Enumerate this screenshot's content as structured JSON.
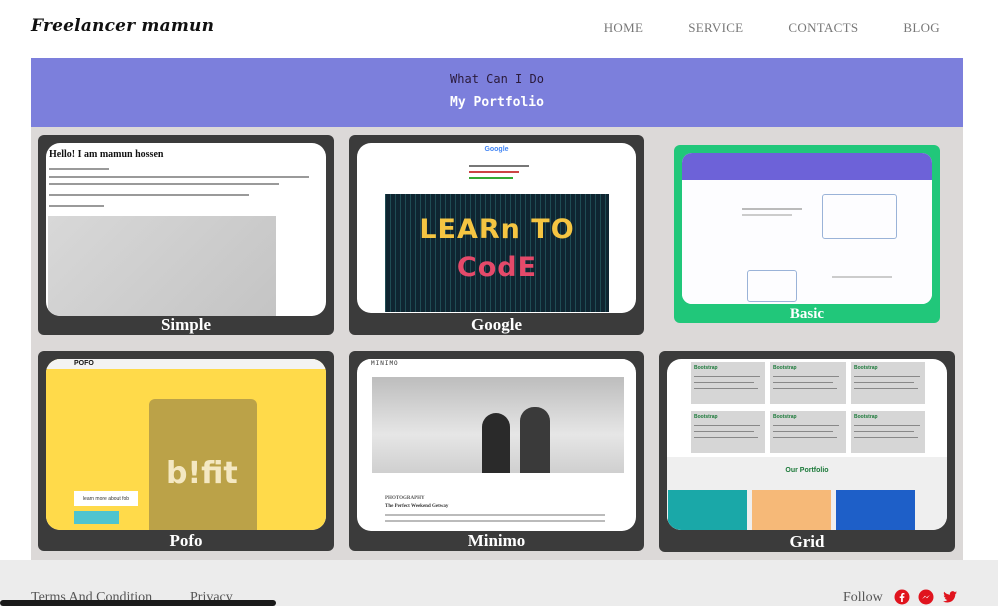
{
  "header": {
    "brand": "Freelancer mamun",
    "nav": [
      "HOME",
      "SERVICE",
      "CONTACTS",
      "BLOG"
    ]
  },
  "banner": {
    "subtitle": "What Can I Do",
    "title": "My Portfolio"
  },
  "portfolio": {
    "cards": [
      {
        "label": "Simple",
        "preview_heading": "Hello! I am mamun hossen"
      },
      {
        "label": "Google",
        "preview_logo": "Google",
        "preview_image_text": [
          "LEARn TO",
          "CodE"
        ]
      },
      {
        "label": "Basic"
      },
      {
        "label": "Pofo",
        "preview_logo": "POFO",
        "preview_image_text": "b!fit",
        "preview_button": "learn more about fob"
      },
      {
        "label": "Minimo",
        "preview_logo": "MINIMO",
        "preview_caption": "PHOTOGRAPHY",
        "preview_title": "The Perfect Weekend Getway"
      },
      {
        "label": "Grid",
        "preview_panel_title": "Bootstrap",
        "preview_section_title": "Our Portfolio"
      }
    ]
  },
  "footer": {
    "links": [
      "Terms And Condition",
      "Privacy"
    ],
    "follow_label": "Follow",
    "social_icons": [
      "facebook-icon",
      "messenger-icon",
      "twitter-icon"
    ]
  },
  "colors": {
    "banner": "#7c7fdc",
    "card": "#3b3b3b",
    "card_highlight": "#21c77a",
    "gallery_bg": "#dcd9d8",
    "social_red": "#e0141e"
  }
}
